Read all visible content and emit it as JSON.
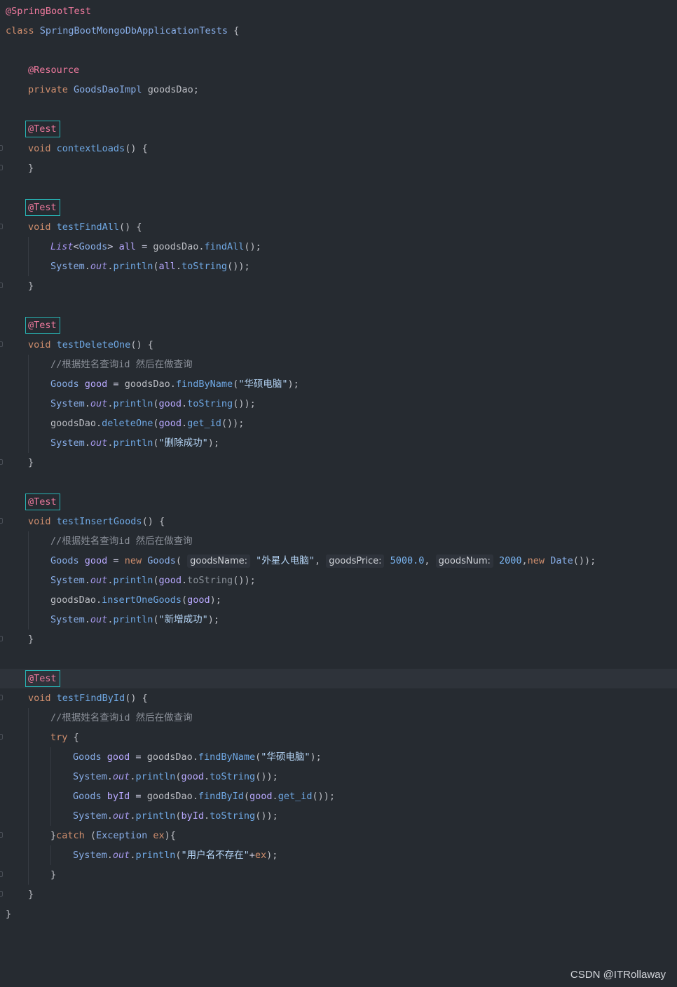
{
  "editor": {
    "lines": [
      {
        "indent": 0,
        "tokens": [
          {
            "t": "@SpringBootTest",
            "k": "anno"
          }
        ]
      },
      {
        "indent": 0,
        "tokens": [
          {
            "t": "class ",
            "k": "kw"
          },
          {
            "t": "SpringBootMongoDbApplicationTests",
            "k": "cls"
          },
          {
            "t": " {",
            "k": "plain"
          }
        ]
      },
      {
        "indent": 0,
        "tokens": []
      },
      {
        "indent": 1,
        "tokens": [
          {
            "t": "@Resource",
            "k": "anno"
          }
        ]
      },
      {
        "indent": 1,
        "tokens": [
          {
            "t": "private ",
            "k": "kw"
          },
          {
            "t": "GoodsDaoImpl",
            "k": "cls"
          },
          {
            "t": " goodsDao;",
            "k": "plain"
          }
        ]
      },
      {
        "indent": 0,
        "tokens": []
      },
      {
        "indent": 1,
        "tokens": [
          {
            "t": "@Test",
            "k": "hl"
          }
        ]
      },
      {
        "indent": 1,
        "fold": true,
        "tokens": [
          {
            "t": "void ",
            "k": "kw"
          },
          {
            "t": "contextLoads",
            "k": "mth"
          },
          {
            "t": "() {",
            "k": "plain"
          }
        ]
      },
      {
        "indent": 1,
        "fold": true,
        "tokens": [
          {
            "t": "}",
            "k": "plain"
          }
        ]
      },
      {
        "indent": 0,
        "tokens": []
      },
      {
        "indent": 1,
        "tokens": [
          {
            "t": "@Test",
            "k": "hl"
          }
        ]
      },
      {
        "indent": 1,
        "fold": true,
        "tokens": [
          {
            "t": "void ",
            "k": "kw"
          },
          {
            "t": "testFindAll",
            "k": "mth"
          },
          {
            "t": "() {",
            "k": "plain"
          }
        ]
      },
      {
        "indent": 2,
        "tokens": [
          {
            "t": "List",
            "k": "iface"
          },
          {
            "t": "<",
            "k": "op"
          },
          {
            "t": "Goods",
            "k": "cls"
          },
          {
            "t": "> ",
            "k": "op"
          },
          {
            "t": "all",
            "k": "var"
          },
          {
            "t": " = ",
            "k": "op"
          },
          {
            "t": "goodsDao",
            "k": "plain"
          },
          {
            "t": ".",
            "k": "plain"
          },
          {
            "t": "findAll",
            "k": "mth"
          },
          {
            "t": "();",
            "k": "plain"
          }
        ]
      },
      {
        "indent": 2,
        "tokens": [
          {
            "t": "System",
            "k": "cls"
          },
          {
            "t": ".",
            "k": "plain"
          },
          {
            "t": "out",
            "k": "ital"
          },
          {
            "t": ".",
            "k": "plain"
          },
          {
            "t": "println",
            "k": "mth"
          },
          {
            "t": "(",
            "k": "plain"
          },
          {
            "t": "all",
            "k": "var"
          },
          {
            "t": ".",
            "k": "plain"
          },
          {
            "t": "toString",
            "k": "mth"
          },
          {
            "t": "());",
            "k": "plain"
          }
        ]
      },
      {
        "indent": 1,
        "fold": true,
        "tokens": [
          {
            "t": "}",
            "k": "plain"
          }
        ]
      },
      {
        "indent": 0,
        "tokens": []
      },
      {
        "indent": 1,
        "tokens": [
          {
            "t": "@Test",
            "k": "hl"
          }
        ]
      },
      {
        "indent": 1,
        "fold": true,
        "tokens": [
          {
            "t": "void ",
            "k": "kw"
          },
          {
            "t": "testDeleteOne",
            "k": "mth"
          },
          {
            "t": "() {",
            "k": "plain"
          }
        ]
      },
      {
        "indent": 2,
        "tokens": [
          {
            "t": "//根据姓名查询id 然后在做查询",
            "k": "cmt"
          }
        ]
      },
      {
        "indent": 2,
        "tokens": [
          {
            "t": "Goods ",
            "k": "cls"
          },
          {
            "t": "good",
            "k": "var"
          },
          {
            "t": " = ",
            "k": "op"
          },
          {
            "t": "goodsDao",
            "k": "plain"
          },
          {
            "t": ".",
            "k": "plain"
          },
          {
            "t": "findByName",
            "k": "mth"
          },
          {
            "t": "(",
            "k": "plain"
          },
          {
            "t": "\"华硕电脑\"",
            "k": "str"
          },
          {
            "t": ");",
            "k": "plain"
          }
        ]
      },
      {
        "indent": 2,
        "tokens": [
          {
            "t": "System",
            "k": "cls"
          },
          {
            "t": ".",
            "k": "plain"
          },
          {
            "t": "out",
            "k": "ital"
          },
          {
            "t": ".",
            "k": "plain"
          },
          {
            "t": "println",
            "k": "mth"
          },
          {
            "t": "(",
            "k": "plain"
          },
          {
            "t": "good",
            "k": "var"
          },
          {
            "t": ".",
            "k": "plain"
          },
          {
            "t": "toString",
            "k": "mth"
          },
          {
            "t": "());",
            "k": "plain"
          }
        ]
      },
      {
        "indent": 2,
        "tokens": [
          {
            "t": "goodsDao",
            "k": "plain"
          },
          {
            "t": ".",
            "k": "plain"
          },
          {
            "t": "deleteOne",
            "k": "mth"
          },
          {
            "t": "(",
            "k": "plain"
          },
          {
            "t": "good",
            "k": "var"
          },
          {
            "t": ".",
            "k": "plain"
          },
          {
            "t": "get_id",
            "k": "mth"
          },
          {
            "t": "());",
            "k": "plain"
          }
        ]
      },
      {
        "indent": 2,
        "tokens": [
          {
            "t": "System",
            "k": "cls"
          },
          {
            "t": ".",
            "k": "plain"
          },
          {
            "t": "out",
            "k": "ital"
          },
          {
            "t": ".",
            "k": "plain"
          },
          {
            "t": "println",
            "k": "mth"
          },
          {
            "t": "(",
            "k": "plain"
          },
          {
            "t": "\"删除成功\"",
            "k": "str"
          },
          {
            "t": ");",
            "k": "plain"
          }
        ]
      },
      {
        "indent": 1,
        "fold": true,
        "tokens": [
          {
            "t": "}",
            "k": "plain"
          }
        ]
      },
      {
        "indent": 0,
        "tokens": []
      },
      {
        "indent": 1,
        "tokens": [
          {
            "t": "@Test",
            "k": "hl"
          }
        ]
      },
      {
        "indent": 1,
        "fold": true,
        "tokens": [
          {
            "t": "void ",
            "k": "kw"
          },
          {
            "t": "testInsertGoods",
            "k": "mth"
          },
          {
            "t": "() {",
            "k": "plain"
          }
        ]
      },
      {
        "indent": 2,
        "tokens": [
          {
            "t": "//根据姓名查询id 然后在做查询",
            "k": "cmt"
          }
        ]
      },
      {
        "indent": 2,
        "tokens": [
          {
            "t": "Goods ",
            "k": "cls"
          },
          {
            "t": "good",
            "k": "var"
          },
          {
            "t": " = ",
            "k": "op"
          },
          {
            "t": "new ",
            "k": "kw"
          },
          {
            "t": "Goods",
            "k": "cls"
          },
          {
            "t": "( ",
            "k": "plain"
          },
          {
            "t": "goodsName:",
            "k": "hint"
          },
          {
            "t": " ",
            "k": "plain"
          },
          {
            "t": "\"外星人电脑\"",
            "k": "str"
          },
          {
            "t": ", ",
            "k": "plain"
          },
          {
            "t": "goodsPrice:",
            "k": "hint"
          },
          {
            "t": " ",
            "k": "plain"
          },
          {
            "t": "5000.0",
            "k": "num"
          },
          {
            "t": ", ",
            "k": "plain"
          },
          {
            "t": "goodsNum:",
            "k": "hint"
          },
          {
            "t": " ",
            "k": "plain"
          },
          {
            "t": "2000",
            "k": "num"
          },
          {
            "t": ",",
            "k": "plain"
          },
          {
            "t": "new ",
            "k": "kw"
          },
          {
            "t": "Date",
            "k": "cls"
          },
          {
            "t": "());",
            "k": "plain"
          }
        ]
      },
      {
        "indent": 2,
        "tokens": [
          {
            "t": "System",
            "k": "cls"
          },
          {
            "t": ".",
            "k": "plain"
          },
          {
            "t": "out",
            "k": "ital"
          },
          {
            "t": ".",
            "k": "plain"
          },
          {
            "t": "println",
            "k": "mth"
          },
          {
            "t": "(",
            "k": "plain"
          },
          {
            "t": "good",
            "k": "var"
          },
          {
            "t": ".",
            "k": "plain"
          },
          {
            "t": "toString",
            "k": "dim"
          },
          {
            "t": "());",
            "k": "plain"
          }
        ]
      },
      {
        "indent": 2,
        "tokens": [
          {
            "t": "goodsDao",
            "k": "plain"
          },
          {
            "t": ".",
            "k": "plain"
          },
          {
            "t": "insertOneGoods",
            "k": "mth"
          },
          {
            "t": "(",
            "k": "plain"
          },
          {
            "t": "good",
            "k": "var"
          },
          {
            "t": ");",
            "k": "plain"
          }
        ]
      },
      {
        "indent": 2,
        "tokens": [
          {
            "t": "System",
            "k": "cls"
          },
          {
            "t": ".",
            "k": "plain"
          },
          {
            "t": "out",
            "k": "ital"
          },
          {
            "t": ".",
            "k": "plain"
          },
          {
            "t": "println",
            "k": "mth"
          },
          {
            "t": "(",
            "k": "plain"
          },
          {
            "t": "\"新增成功\"",
            "k": "str"
          },
          {
            "t": ");",
            "k": "plain"
          }
        ]
      },
      {
        "indent": 1,
        "fold": true,
        "tokens": [
          {
            "t": "}",
            "k": "plain"
          }
        ]
      },
      {
        "indent": 0,
        "tokens": []
      },
      {
        "indent": 1,
        "current": true,
        "tokens": [
          {
            "t": "@Test",
            "k": "hl"
          }
        ]
      },
      {
        "indent": 1,
        "fold": true,
        "tokens": [
          {
            "t": "void ",
            "k": "kw"
          },
          {
            "t": "testFindById",
            "k": "mth"
          },
          {
            "t": "() {",
            "k": "plain"
          }
        ]
      },
      {
        "indent": 2,
        "tokens": [
          {
            "t": "//根据姓名查询id 然后在做查询",
            "k": "cmt"
          }
        ]
      },
      {
        "indent": 2,
        "fold": true,
        "tokens": [
          {
            "t": "try",
            "k": "kw"
          },
          {
            "t": " {",
            "k": "plain"
          }
        ]
      },
      {
        "indent": 3,
        "tokens": [
          {
            "t": "Goods ",
            "k": "cls"
          },
          {
            "t": "good",
            "k": "var"
          },
          {
            "t": " = ",
            "k": "op"
          },
          {
            "t": "goodsDao",
            "k": "plain"
          },
          {
            "t": ".",
            "k": "plain"
          },
          {
            "t": "findByName",
            "k": "mth"
          },
          {
            "t": "(",
            "k": "plain"
          },
          {
            "t": "\"华硕电脑\"",
            "k": "str"
          },
          {
            "t": ");",
            "k": "plain"
          }
        ]
      },
      {
        "indent": 3,
        "tokens": [
          {
            "t": "System",
            "k": "cls"
          },
          {
            "t": ".",
            "k": "plain"
          },
          {
            "t": "out",
            "k": "ital"
          },
          {
            "t": ".",
            "k": "plain"
          },
          {
            "t": "println",
            "k": "mth"
          },
          {
            "t": "(",
            "k": "plain"
          },
          {
            "t": "good",
            "k": "var"
          },
          {
            "t": ".",
            "k": "plain"
          },
          {
            "t": "toString",
            "k": "mth"
          },
          {
            "t": "());",
            "k": "plain"
          }
        ]
      },
      {
        "indent": 3,
        "tokens": [
          {
            "t": "Goods ",
            "k": "cls"
          },
          {
            "t": "byId",
            "k": "var"
          },
          {
            "t": " = ",
            "k": "op"
          },
          {
            "t": "goodsDao",
            "k": "plain"
          },
          {
            "t": ".",
            "k": "plain"
          },
          {
            "t": "findById",
            "k": "mth"
          },
          {
            "t": "(",
            "k": "plain"
          },
          {
            "t": "good",
            "k": "var"
          },
          {
            "t": ".",
            "k": "plain"
          },
          {
            "t": "get_id",
            "k": "mth"
          },
          {
            "t": "());",
            "k": "plain"
          }
        ]
      },
      {
        "indent": 3,
        "tokens": [
          {
            "t": "System",
            "k": "cls"
          },
          {
            "t": ".",
            "k": "plain"
          },
          {
            "t": "out",
            "k": "ital"
          },
          {
            "t": ".",
            "k": "plain"
          },
          {
            "t": "println",
            "k": "mth"
          },
          {
            "t": "(",
            "k": "plain"
          },
          {
            "t": "byId",
            "k": "var"
          },
          {
            "t": ".",
            "k": "plain"
          },
          {
            "t": "toString",
            "k": "mth"
          },
          {
            "t": "());",
            "k": "plain"
          }
        ]
      },
      {
        "indent": 2,
        "fold": true,
        "tokens": [
          {
            "t": "}",
            "k": "plain"
          },
          {
            "t": "catch",
            "k": "kw"
          },
          {
            "t": " (",
            "k": "plain"
          },
          {
            "t": "Exception ",
            "k": "cls"
          },
          {
            "t": "ex",
            "k": "kw"
          },
          {
            "t": "){",
            "k": "plain"
          }
        ]
      },
      {
        "indent": 3,
        "tokens": [
          {
            "t": "System",
            "k": "cls"
          },
          {
            "t": ".",
            "k": "plain"
          },
          {
            "t": "out",
            "k": "ital"
          },
          {
            "t": ".",
            "k": "plain"
          },
          {
            "t": "println",
            "k": "mth"
          },
          {
            "t": "(",
            "k": "plain"
          },
          {
            "t": "\"用户名不存在\"",
            "k": "str"
          },
          {
            "t": "+",
            "k": "op"
          },
          {
            "t": "ex",
            "k": "kw"
          },
          {
            "t": ");",
            "k": "plain"
          }
        ]
      },
      {
        "indent": 2,
        "fold": true,
        "tokens": [
          {
            "t": "}",
            "k": "plain"
          }
        ]
      },
      {
        "indent": 1,
        "fold": true,
        "tokens": [
          {
            "t": "}",
            "k": "plain"
          }
        ]
      },
      {
        "indent": 0,
        "tokens": [
          {
            "t": "}",
            "k": "plain"
          }
        ]
      }
    ]
  },
  "watermark": "CSDN @ITRollaway"
}
